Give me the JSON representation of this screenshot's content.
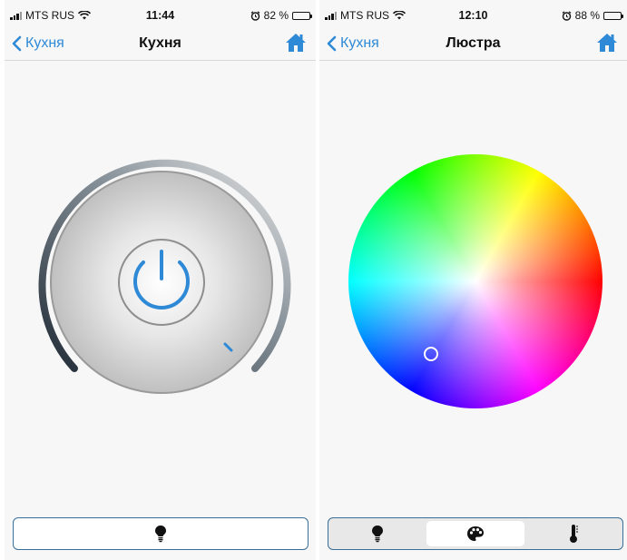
{
  "left": {
    "status": {
      "carrier": "MTS RUS",
      "time": "11:44",
      "battery": "82 %",
      "battery_level": 0.82
    },
    "nav": {
      "back_label": "Кухня",
      "title": "Кухня"
    },
    "dimmer": {
      "level": 0.62,
      "power": "on"
    },
    "tabs": [
      {
        "icon": "bulb-icon",
        "active": true
      }
    ]
  },
  "right": {
    "status": {
      "carrier": "MTS RUS",
      "time": "12:10",
      "battery": "88 %",
      "battery_level": 0.88
    },
    "nav": {
      "back_label": "Кухня",
      "title": "Люстра"
    },
    "tabs": [
      {
        "icon": "bulb-icon",
        "active": false
      },
      {
        "icon": "palette-icon",
        "active": true
      },
      {
        "icon": "thermometer-icon",
        "active": false
      }
    ]
  },
  "colors": {
    "accent": "#2e89d6",
    "tab_border": "#3a6f9a"
  }
}
